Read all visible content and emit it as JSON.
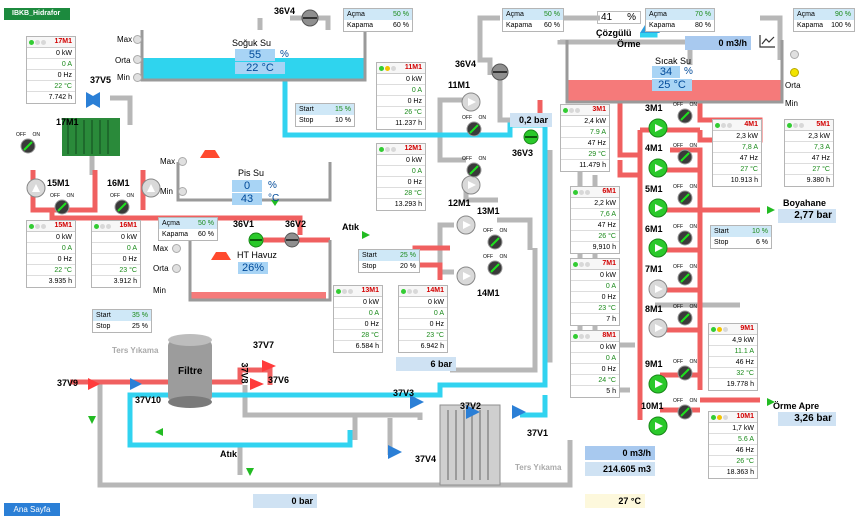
{
  "header": {
    "title": "IBKB_Hidrafor",
    "home": "Ana Sayfa"
  },
  "tanks": {
    "soguk_su": {
      "name": "Soğuk Su",
      "level": "55",
      "level_unit": "%",
      "temp": "22 °C"
    },
    "pis_su": {
      "name": "Pis Su",
      "level": "0",
      "level_unit": "%",
      "temp": "43",
      "temp_unit": "°C"
    },
    "sicak_su": {
      "name": "Sıcak Su",
      "level": "34",
      "level_unit": "%",
      "temp": "25 °C"
    },
    "ht_havuz": {
      "name": "HT Havuz",
      "level": "26%"
    },
    "filtre": "Filtre"
  },
  "level_labels": {
    "max": "Max",
    "orta": "Orta",
    "min": "Min"
  },
  "valves": {
    "v36V4a": "36V4",
    "v36V4b": "36V4",
    "v37V5": "37V5",
    "v36V1": "36V1",
    "v36V2": "36V2",
    "v36V3": "36V3",
    "v37V7": "37V7",
    "v37V6": "37V6",
    "v37V8": "37V8",
    "v37V9": "37V9",
    "v37V10": "37V10",
    "v37V3": "37V3",
    "v37V2": "37V2",
    "v37V1": "37V1",
    "v37V4": "37V4"
  },
  "motors": {
    "m17": "17M1",
    "m15": "15M1",
    "m16": "16M1",
    "m11": "11M1",
    "m12": "12M1",
    "m13": "13M1",
    "m14": "14M1",
    "m3": "3M1",
    "m4": "4M1",
    "m5": "5M1",
    "m6": "6M1",
    "m7": "7M1",
    "m8": "8M1",
    "m9": "9M1",
    "m10": "10M1"
  },
  "switch": {
    "off": "OFF",
    "on": "ON"
  },
  "cards": {
    "c17": {
      "name": "17M1",
      "kw": "0 kW",
      "a": "0 A",
      "hz": "0 Hz",
      "t": "22 °C",
      "h": "7.742 h"
    },
    "c11": {
      "name": "11M1",
      "kw": "0 kW",
      "a": "0 A",
      "hz": "0 Hz",
      "t": "26 °C",
      "h": "11.237 h"
    },
    "c12": {
      "name": "12M1",
      "kw": "0 kW",
      "a": "0 A",
      "hz": "0 Hz",
      "t": "28 °C",
      "h": "13.293 h"
    },
    "c15": {
      "name": "15M1",
      "kw": "0 kW",
      "a": "0 A",
      "hz": "0 Hz",
      "t": "22 °C",
      "h": "3.935 h"
    },
    "c16": {
      "name": "16M1",
      "kw": "0 kW",
      "a": "0 A",
      "hz": "0 Hz",
      "t": "23 °C",
      "h": "3.912 h"
    },
    "c13": {
      "name": "13M1",
      "kw": "0 kW",
      "a": "0 A",
      "hz": "0 Hz",
      "t": "28 °C",
      "h": "6.584 h"
    },
    "c14": {
      "name": "14M1",
      "kw": "0 kW",
      "a": "0 A",
      "hz": "0 Hz",
      "t": "23 °C",
      "h": "6.942 h"
    },
    "c3": {
      "name": "3M1",
      "kw": "2,4 kW",
      "a": "7.9 A",
      "hz": "47 Hz",
      "t": "29 °C",
      "h": "11.479 h"
    },
    "c6": {
      "name": "6M1",
      "kw": "2,2 kW",
      "a": "7,6 A",
      "hz": "47 Hz",
      "t": "26 °C",
      "h": "9,910 h"
    },
    "c7": {
      "name": "7M1",
      "kw": "0 kW",
      "a": "0 A",
      "hz": "0 Hz",
      "t": "23 °C",
      "h": "7 h"
    },
    "c8": {
      "name": "8M1",
      "kw": "0 kW",
      "a": "0 A",
      "hz": "0 Hz",
      "t": "24 °C",
      "h": "5 h"
    },
    "c4": {
      "name": "4M1",
      "kw": "2,3 kW",
      "a": "7,8 A",
      "hz": "47 Hz",
      "t": "27 °C",
      "h": "10.913 h"
    },
    "c5": {
      "name": "5M1",
      "kw": "2,3 kW",
      "a": "7,3 A",
      "hz": "47 Hz",
      "t": "27 °C",
      "h": "9.380 h"
    },
    "c9": {
      "name": "9M1",
      "kw": "4,9 kW",
      "a": "11.1 A",
      "hz": "46 Hz",
      "t": "32 °C",
      "h": "19.778 h"
    },
    "c10": {
      "name": "10M1",
      "kw": "1,7 kW",
      "a": "5.6 A",
      "hz": "46 Hz",
      "t": "26 °C",
      "h": "18.363 h"
    }
  },
  "control_panels": {
    "p1": {
      "open": "Açma",
      "open_v": "50 %",
      "close": "Kapama",
      "close_v": "60 %"
    },
    "p2": {
      "open": "Açma",
      "open_v": "50 %",
      "close": "Kapama",
      "close_v": "60 %"
    },
    "p3": {
      "open": "Açma",
      "open_v": "70 %",
      "close": "Kapama",
      "close_v": "80 %"
    },
    "p4": {
      "open": "Açma",
      "open_v": "90 %",
      "close": "Kapama",
      "close_v": "100 %"
    },
    "p5": {
      "open": "Açma",
      "open_v": "50 %",
      "close": "Kapama",
      "close_v": "60 %"
    }
  },
  "start_stop": {
    "s1": {
      "start": "Start",
      "start_v": "15 %",
      "stop": "Stop",
      "stop_v": "10 %"
    },
    "s2": {
      "start": "Start",
      "start_v": "25 %",
      "stop": "Stop",
      "stop_v": "20 %"
    },
    "s3": {
      "start": "Start",
      "start_v": "35 %",
      "stop": "Stop",
      "stop_v": "25 %"
    },
    "s4": {
      "start": "Start",
      "start_v": "10 %",
      "stop": "Stop",
      "stop_v": "6 %"
    }
  },
  "readouts": {
    "pct41": "41",
    "pct41_unit": "%",
    "flow_top": "0 m3/h",
    "p02": "0,2 bar",
    "p6": "6 bar",
    "p0": "0 bar",
    "flow_bottom": "0 m3/h",
    "total": "214.605 m3",
    "temp_bottom": "27 °C",
    "boyahane": "Boyahane",
    "boyahane_p": "2,77 bar",
    "orme_apre": "Örme Apre",
    "orme_apre_p": "3,26 bar"
  },
  "labels": {
    "cozgulu": "Çözgülü",
    "orme": "Örme",
    "atik1": "Atık",
    "atik2": "Atık",
    "ters1": "Ters Yıkama",
    "ters2": "Ters Yıkama"
  }
}
